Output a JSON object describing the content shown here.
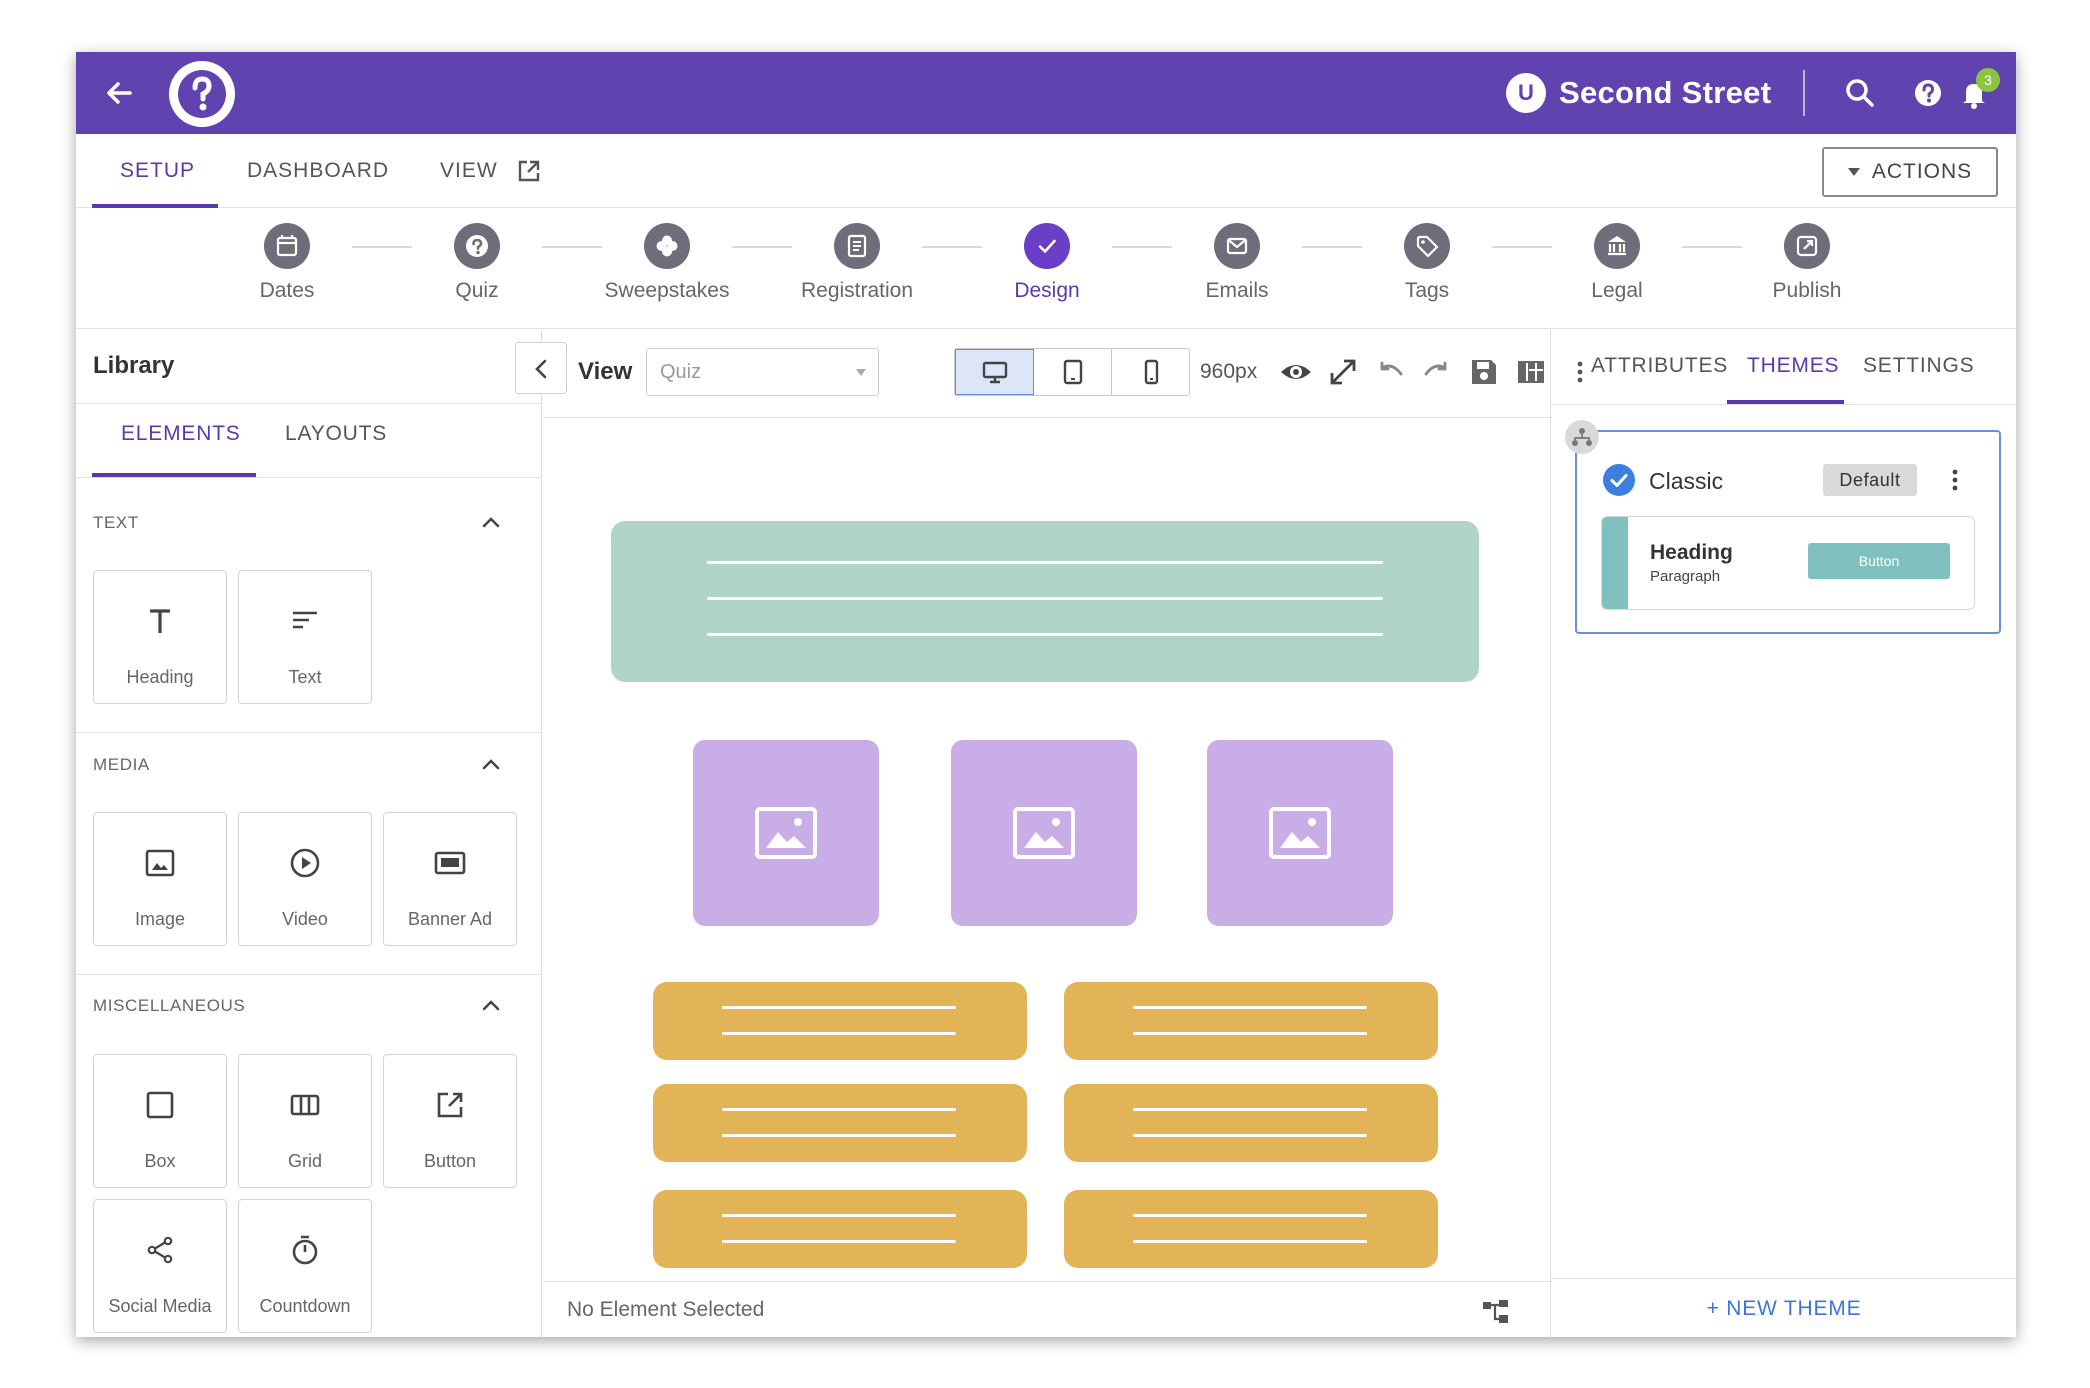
{
  "topbar": {
    "brand_badge": "U",
    "brand_name": "Second Street",
    "notification_count": "3",
    "colors": {
      "bar": "#6143b0",
      "badge": "#8cc63f"
    }
  },
  "tabs": [
    {
      "label": "SETUP",
      "active": true
    },
    {
      "label": "DASHBOARD",
      "active": false
    },
    {
      "label": "VIEW",
      "active": false
    }
  ],
  "actions_label": "ACTIONS",
  "steps": [
    {
      "label": "Dates",
      "icon": "calendar-icon"
    },
    {
      "label": "Quiz",
      "icon": "question-icon"
    },
    {
      "label": "Sweepstakes",
      "icon": "clover-icon"
    },
    {
      "label": "Registration",
      "icon": "clipboard-icon"
    },
    {
      "label": "Design",
      "icon": "check-icon",
      "active": true
    },
    {
      "label": "Emails",
      "icon": "envelope-icon"
    },
    {
      "label": "Tags",
      "icon": "tag-icon"
    },
    {
      "label": "Legal",
      "icon": "bank-icon"
    },
    {
      "label": "Publish",
      "icon": "external-link-icon"
    }
  ],
  "library": {
    "title": "Library",
    "tabs": [
      {
        "label": "ELEMENTS",
        "active": true
      },
      {
        "label": "LAYOUTS",
        "active": false
      }
    ],
    "sections": [
      {
        "title": "TEXT",
        "items": [
          "Heading",
          "Text"
        ]
      },
      {
        "title": "MEDIA",
        "items": [
          "Image",
          "Video",
          "Banner Ad"
        ]
      },
      {
        "title": "MISCELLANEOUS",
        "items": [
          "Box",
          "Grid",
          "Button",
          "Social Media",
          "Countdown"
        ]
      }
    ]
  },
  "canvas_toolbar": {
    "view_label": "View",
    "view_select_value": "Quiz",
    "width_label": "960px"
  },
  "canvas_footer": {
    "status": "No Element Selected"
  },
  "right_panel": {
    "tabs": [
      {
        "label": "ATTRIBUTES",
        "active": false
      },
      {
        "label": "THEMES",
        "active": true
      },
      {
        "label": "SETTINGS",
        "active": false
      }
    ],
    "theme": {
      "name": "Classic",
      "badge": "Default",
      "preview_heading": "Heading",
      "preview_paragraph": "Paragraph",
      "preview_button": "Button",
      "accent_color": "#80c1bf"
    },
    "new_theme_label": "+ NEW THEME"
  },
  "colors": {
    "accent": "#5a3aab",
    "hero": "#b0d4c6",
    "image_blocks": "#c9ade6",
    "button_blocks": "#e2b457",
    "link": "#3d74d8"
  }
}
